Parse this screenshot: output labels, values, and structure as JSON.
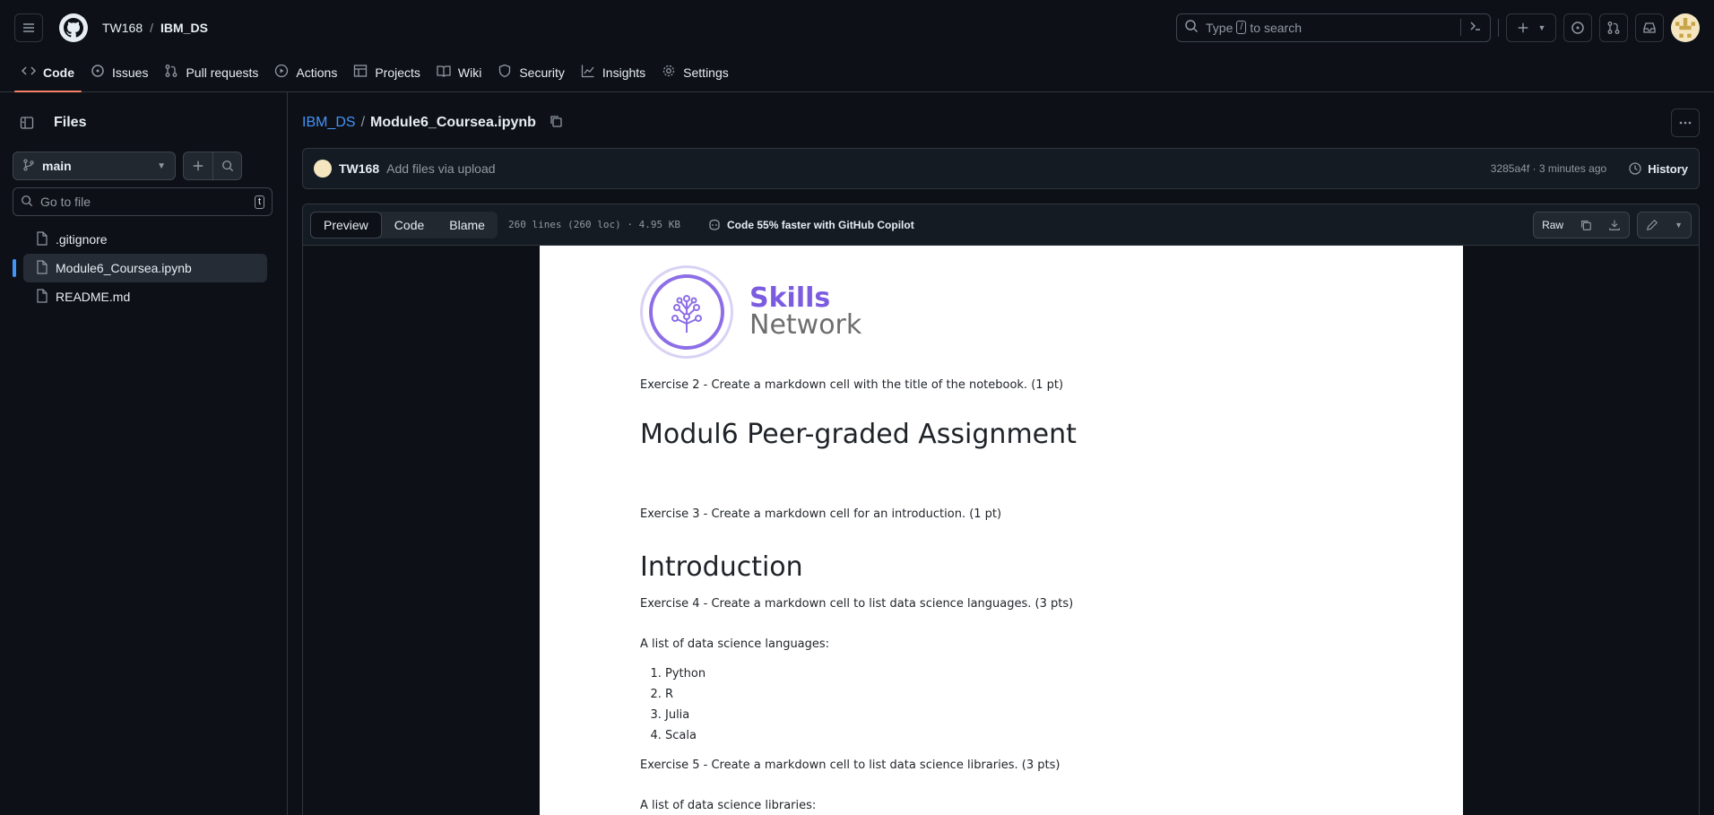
{
  "header": {
    "owner": "TW168",
    "repo": "IBM_DS",
    "search_placeholder_pre": "Type",
    "search_key": "/",
    "search_placeholder_post": "to search"
  },
  "nav": {
    "tabs": [
      {
        "label": "Code",
        "icon": "code-icon"
      },
      {
        "label": "Issues",
        "icon": "issue-icon"
      },
      {
        "label": "Pull requests",
        "icon": "pull-request-icon"
      },
      {
        "label": "Actions",
        "icon": "play-icon"
      },
      {
        "label": "Projects",
        "icon": "table-icon"
      },
      {
        "label": "Wiki",
        "icon": "book-icon"
      },
      {
        "label": "Security",
        "icon": "shield-icon"
      },
      {
        "label": "Insights",
        "icon": "graph-icon"
      },
      {
        "label": "Settings",
        "icon": "gear-icon"
      }
    ]
  },
  "sidebar": {
    "title": "Files",
    "branch": "main",
    "goto_placeholder": "Go to file",
    "goto_key": "t",
    "files": [
      {
        "name": ".gitignore"
      },
      {
        "name": "Module6_Coursea.ipynb"
      },
      {
        "name": "README.md"
      }
    ]
  },
  "path": {
    "repo": "IBM_DS",
    "sep": "/",
    "file": "Module6_Coursea.ipynb"
  },
  "commit": {
    "author": "TW168",
    "message": "Add files via upload",
    "meta": "3285a4f · 3 minutes ago",
    "history_label": "History"
  },
  "file_toolbar": {
    "tabs": [
      "Preview",
      "Code",
      "Blame"
    ],
    "info": "260 lines (260 loc) · 4.95 KB",
    "copilot": "Code 55% faster with GitHub Copilot",
    "raw_label": "Raw"
  },
  "notebook": {
    "logo_line1": "Skills",
    "logo_line2": "Network",
    "ex2": "Exercise 2 - Create a markdown cell with the title of the notebook. (1 pt)",
    "title": "Modul6 Peer-graded Assignment",
    "ex3": "Exercise 3 - Create a markdown cell for an introduction. (1 pt)",
    "intro_heading": "Introduction",
    "ex4": "Exercise 4 - Create a markdown cell to list data science languages. (3 pts)",
    "lang_lead": "A list of data science languages:",
    "languages": [
      "Python",
      "R",
      "Julia",
      "Scala"
    ],
    "ex5": "Exercise 5 - Create a markdown cell to list data science libraries. (3 pts)",
    "lib_lead": "A list of data science libraries:"
  }
}
